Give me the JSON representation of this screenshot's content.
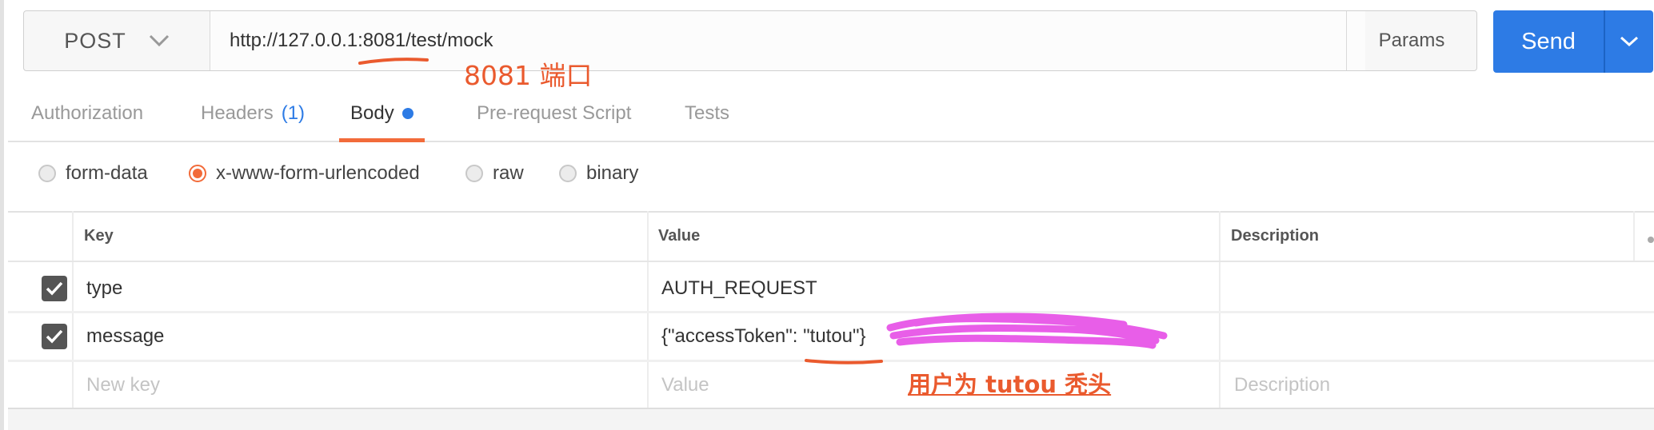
{
  "request": {
    "method": "POST",
    "url": "http://127.0.0.1:8081/test/mock",
    "params_label": "Params",
    "send_label": "Send"
  },
  "annotations": {
    "port_note": "8081 端口",
    "user_note": "用户为 tutou 秃头",
    "color": "#ea5a2e"
  },
  "tabs": [
    {
      "label": "Authorization"
    },
    {
      "label": "Headers",
      "count": "(1)"
    },
    {
      "label": "Body",
      "active": true
    },
    {
      "label": "Pre-request Script"
    },
    {
      "label": "Tests"
    }
  ],
  "body_types": [
    {
      "label": "form-data",
      "selected": false
    },
    {
      "label": "x-www-form-urlencoded",
      "selected": true
    },
    {
      "label": "raw",
      "selected": false
    },
    {
      "label": "binary",
      "selected": false
    }
  ],
  "table": {
    "columns": [
      "Key",
      "Value",
      "Description"
    ],
    "rows": [
      {
        "checked": true,
        "key": "type",
        "value": "AUTH_REQUEST",
        "description": ""
      },
      {
        "checked": true,
        "key": "message",
        "value": "{\"accessToken\": \"tutou\"}",
        "description": ""
      }
    ],
    "placeholders": {
      "key": "New key",
      "value": "Value",
      "description": "Description"
    }
  },
  "colors": {
    "accent": "#f26b3a",
    "send_blue": "#2d7be5",
    "redaction": "#e85ee8"
  }
}
